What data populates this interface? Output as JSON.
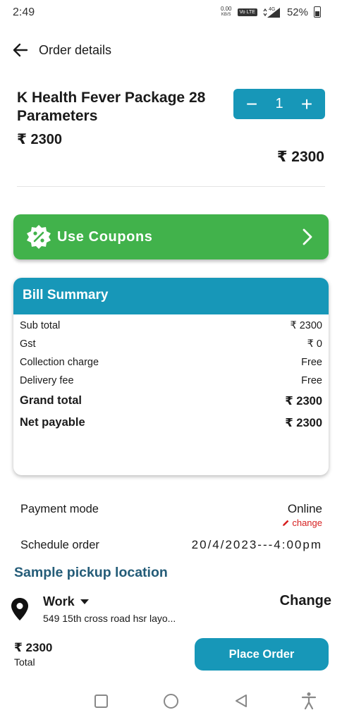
{
  "status_bar": {
    "time": "2:49",
    "speed": "0.00",
    "speed_unit": "KB/S",
    "network": "4G",
    "battery": "52%"
  },
  "header": {
    "title": "Order details"
  },
  "product": {
    "name": "K Health Fever Package 28 Parameters",
    "price": "₹ 2300",
    "quantity": "1",
    "total": "₹ 2300"
  },
  "coupon": {
    "label": "Use Coupons"
  },
  "bill": {
    "title": "Bill Summary",
    "rows": [
      {
        "label": "Sub total",
        "value": "₹ 2300"
      },
      {
        "label": "Gst",
        "value": "₹ 0"
      },
      {
        "label": "Collection charge",
        "value": "Free"
      },
      {
        "label": "Delivery fee",
        "value": "Free"
      },
      {
        "label": "Grand total",
        "value": "₹ 2300"
      },
      {
        "label": "Net payable",
        "value": "₹ 2300"
      }
    ]
  },
  "payment": {
    "label": "Payment mode",
    "value": "Online",
    "change": "change"
  },
  "schedule": {
    "label": "Schedule order",
    "value": "20/4/2023---4:00pm"
  },
  "pickup": {
    "title": "Sample pickup location",
    "name": "Work",
    "address": "549 15th cross road hsr layo...",
    "change": "Change"
  },
  "footer": {
    "total_amount": "₹ 2300",
    "total_label": "Total",
    "place_order": "Place Order"
  },
  "colors": {
    "primary": "#1797b8",
    "coupon": "#41b24b",
    "pickup_title": "#245c78",
    "change": "#d61f1f"
  }
}
